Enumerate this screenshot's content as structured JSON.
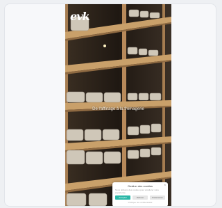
{
  "brand": {
    "logo_text": "evk"
  },
  "hero": {
    "tagline": "De l'affinage à la fromagerie"
  },
  "cookie_banner": {
    "title": "Gestion des cookies",
    "text": "Nous utilisons des cookies pour améliorer votre expérience.",
    "close": "×",
    "accept_label": "Accepter",
    "refuse_label": "Refuser",
    "settings_label": "Paramètres",
    "links": "Politique de confidentialité"
  },
  "colors": {
    "accent": "#2bb7a7",
    "shelf_wood": "#c9a06a",
    "cheese": "#cfc7b8"
  }
}
